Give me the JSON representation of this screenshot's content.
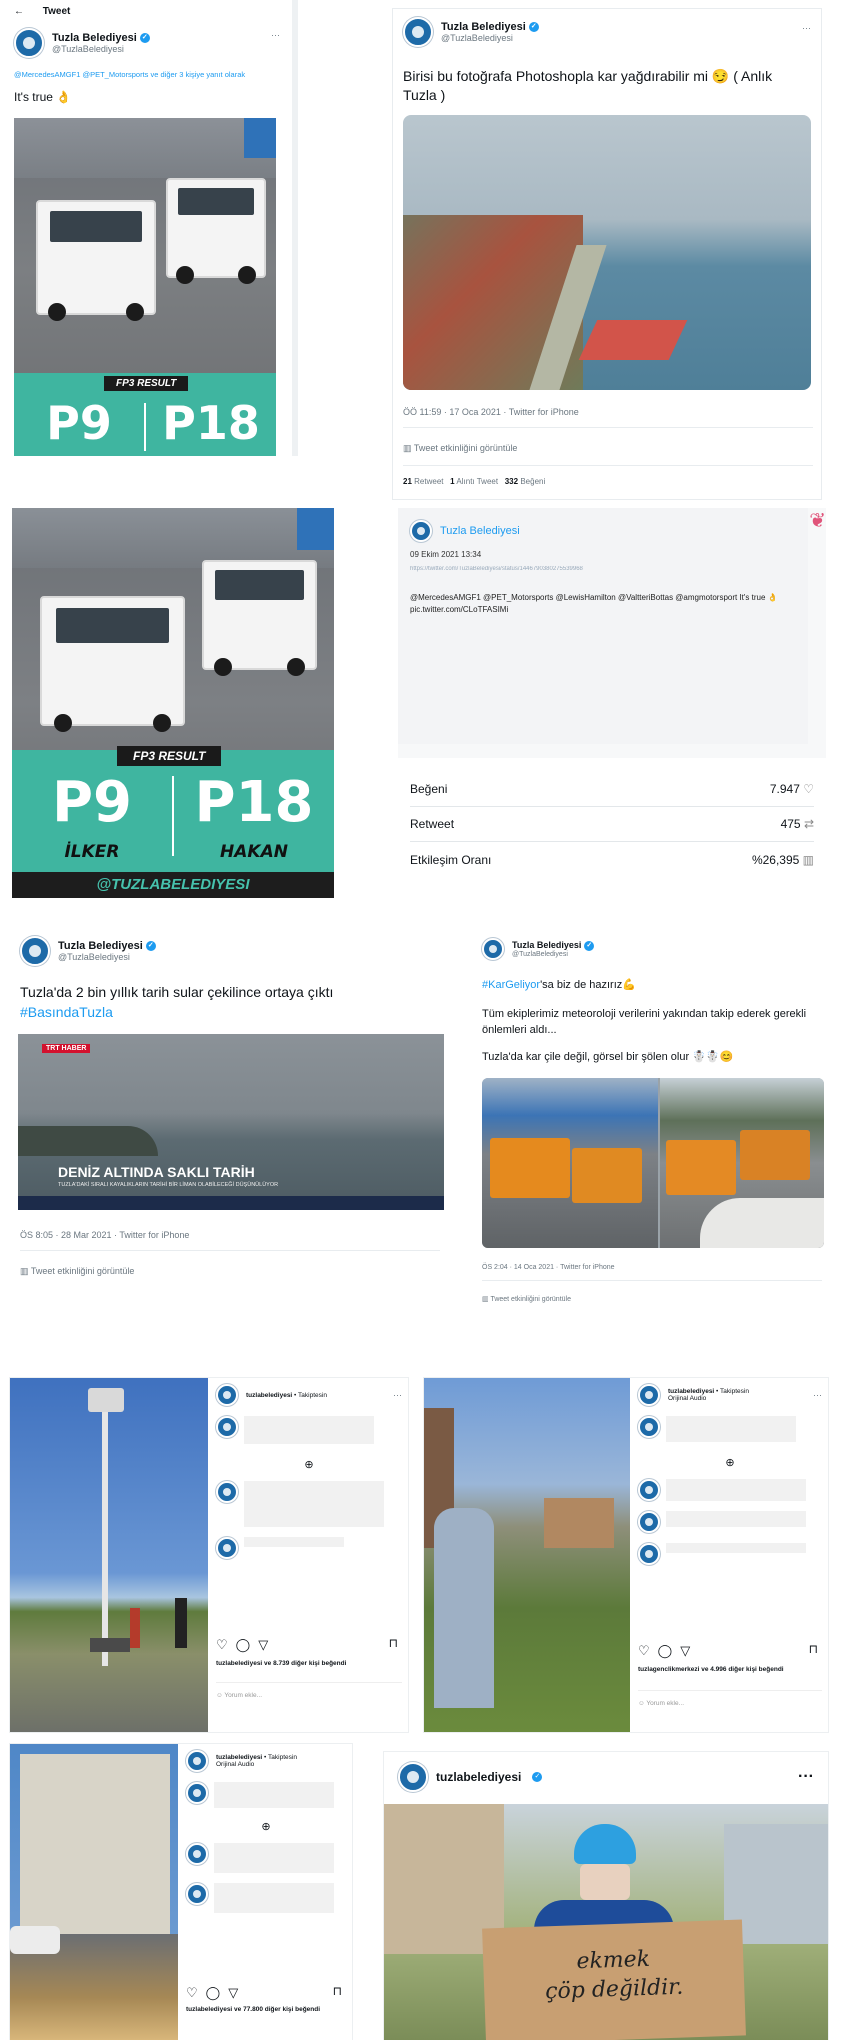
{
  "tweet1": {
    "back_label": "Tweet",
    "name": "Tuzla Belediyesi",
    "handle": "@TuzlaBelediyesi",
    "reply_to": "@MercedesAMGF1 @PET_Motorsports ve diğer 3 kişiye yanıt olarak",
    "text": "It's true 👌",
    "banner": "FP3 RESULT",
    "p1": "P9",
    "p2": "P18"
  },
  "tweet2": {
    "name": "Tuzla Belediyesi",
    "handle": "@TuzlaBelediyesi",
    "text": "Birisi bu fotoğrafa Photoshopla kar yağdırabilir mi 😏 ( Anlık Tuzla )",
    "meta": "ÖÖ 11:59 · 17 Oca 2021 · Twitter for iPhone",
    "activity": "Tweet etkinliğini görüntüle",
    "retweets": "21",
    "retweets_label": "Retweet",
    "quotes": "1",
    "quotes_label": "Alıntı Tweet",
    "likes": "332",
    "likes_label": "Beğeni"
  },
  "fp3_image": {
    "banner": "FP3 RESULT",
    "p1": "P9",
    "p2": "P18",
    "name1": "İLKER",
    "name2": "HAKAN",
    "footer": "@TUZLABELEDIYESI"
  },
  "stats_card": {
    "name": "Tuzla Belediyesi",
    "date": "09 Ekim 2021 13:34",
    "link": "https://twitter.com/TuzlaBelediyesi/status/1446790380275539968",
    "text": "@MercedesAMGF1 @PET_Motorsports @LewisHamilton @ValtteriBottas @amgmotorsport It's true 👌 pic.twitter.com/CLoTFASIMi",
    "rows": [
      {
        "label": "Beğeni",
        "value": "7.947",
        "icon": "heart-icon",
        "glyph": "♡"
      },
      {
        "label": "Retweet",
        "value": "475",
        "icon": "retweet-icon",
        "glyph": "⇄"
      },
      {
        "label": "Etkileşim Oranı",
        "value": "%26,395",
        "icon": "bar-chart-icon",
        "glyph": "▥"
      }
    ]
  },
  "tweet3": {
    "name": "Tuzla Belediyesi",
    "handle": "@TuzlaBelediyesi",
    "text": "Tuzla'da 2 bin yıllık tarih sular çekilince ortaya çıktı",
    "hashtag": "#BasındaTuzla",
    "tv_logo": "TRT HABER",
    "headline": "DENİZ ALTINDA SAKLI TARİH",
    "subline": "TUZLA'DAKİ SIRALI KAYALIKLARIN TARİHİ BİR LİMAN OLABİLECEĞİ DÜŞÜNÜLÜYOR",
    "meta": "ÖS 8:05 · 28 Mar 2021 · Twitter for iPhone",
    "activity": "Tweet etkinliğini görüntüle"
  },
  "tweet4": {
    "name": "Tuzla Belediyesi",
    "handle": "@TuzlaBelediyesi",
    "hashtag": "#KarGeliyor",
    "text1": "'sa biz de hazırız💪",
    "text2": "Tüm ekiplerimiz meteoroloji verilerini yakından takip ederek gerekli önlemleri aldı...",
    "text3": "Tuzla'da kar çile değil, görsel bir şölen olur ☃️☃️😊",
    "meta": "ÖS 2:04 · 14 Oca 2021 · Twitter for iPhone",
    "activity": "Tweet etkinliğini görüntüle"
  },
  "insta1": {
    "account": "tuzlabelediyesi",
    "follow": "Takiptesin",
    "likes": "tuzlabelediyesi ve 8.739 diğer kişi beğendi",
    "comment_placeholder": "Yorum ekle..."
  },
  "insta2": {
    "account": "tuzlabelediyesi",
    "follow": "Takiptesin",
    "sub": "Orijinal Audio",
    "likes": "tuzlagenclikmerkezi ve 4.996 diğer kişi beğendi",
    "comment_placeholder": "Yorum ekle..."
  },
  "insta3": {
    "account": "tuzlabelediyesi",
    "follow": "Takiptesin",
    "sub": "Orijinal Audio",
    "likes": "tuzlabelediyesi ve 77.800 diğer kişi beğendi"
  },
  "insta4": {
    "account": "tuzlabelediyesi",
    "sign_line1": "ekmek",
    "sign_line2": "çöp değildir."
  }
}
